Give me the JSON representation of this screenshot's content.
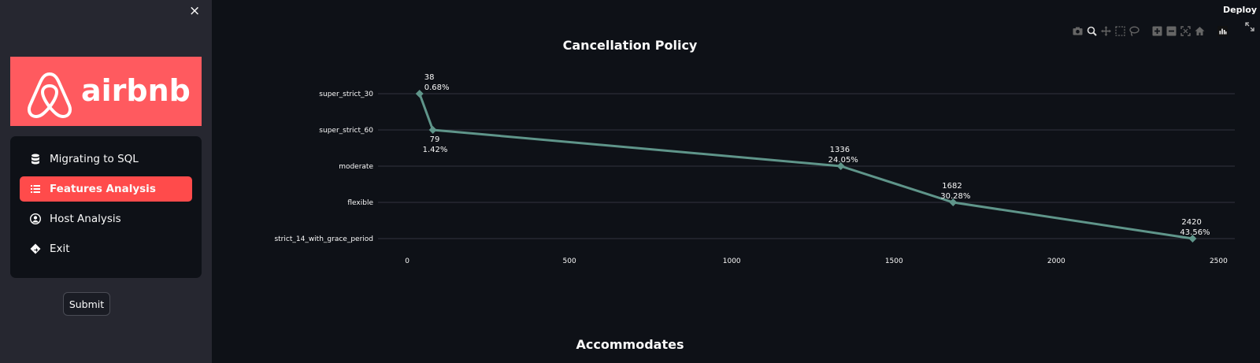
{
  "sidebar": {
    "close_label": "×",
    "logo_text": "airbnb",
    "nav": [
      {
        "label": "Migrating to SQL",
        "icon": "database-icon",
        "active": false
      },
      {
        "label": "Features Analysis",
        "icon": "list-icon",
        "active": true
      },
      {
        "label": "Host Analysis",
        "icon": "user-circle-icon",
        "active": false
      },
      {
        "label": "Exit",
        "icon": "exit-diamond-icon",
        "active": false
      }
    ],
    "submit_label": "Submit"
  },
  "header": {
    "deploy_label": "Deploy"
  },
  "toolbar": {
    "icons": [
      "camera-icon",
      "zoom-icon",
      "pan-icon",
      "box-select-icon",
      "lasso-icon",
      "zoom-in-icon",
      "zoom-out-icon",
      "autoscale-icon",
      "home-icon",
      "plotly-logo-icon"
    ]
  },
  "colors": {
    "accent": "#ff4b4b",
    "logo_bg": "#ff5a5f",
    "line": "#5f958a",
    "sidebar_bg": "#262730",
    "main_bg": "#0e1117"
  },
  "chart_data": {
    "type": "line",
    "title": "Cancellation Policy",
    "xlim": [
      -90,
      2550
    ],
    "xticks": [
      0,
      500,
      1000,
      1500,
      2000,
      2500
    ],
    "categories": [
      "super_strict_30",
      "super_strict_60",
      "moderate",
      "flexible",
      "strict_14_with_grace_period"
    ],
    "values": [
      38,
      79,
      1336,
      1682,
      2420
    ],
    "labels": [
      "38",
      "79",
      "1336",
      "1682",
      "2420"
    ],
    "percents": [
      "0.68%",
      "1.42%",
      "24.05%",
      "30.28%",
      "43.56%"
    ],
    "grid": true
  },
  "next_chart": {
    "title": "Accommodates"
  }
}
